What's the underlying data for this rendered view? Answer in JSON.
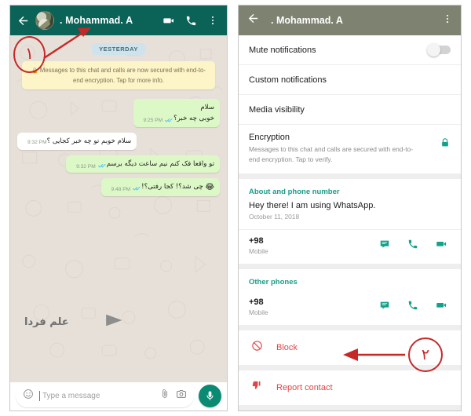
{
  "left_phone": {
    "header": {
      "back_icon": "back-arrow-icon",
      "avatar": "contact-avatar",
      "contact_name": ". Mohammad. A",
      "video_call_icon": "video-call-icon",
      "voice_call_icon": "phone-call-icon",
      "menu_icon": "overflow-menu-icon"
    },
    "chat": {
      "day_divider": "YESTERDAY",
      "encryption_notice": "Messages to this chat and calls are now secured with end-to-end encryption. Tap for more info.",
      "messages": [
        {
          "direction": "out",
          "line1": "سلام",
          "line2": "خوبی چه خبر؟",
          "time": "9:25 PM",
          "status": "read"
        },
        {
          "direction": "in",
          "line1": "سلام خوبم تو چه خبر کجایی ؟",
          "line2": "",
          "time": "9:32 PM",
          "status": "none"
        },
        {
          "direction": "out",
          "line1": "تو واقعا فک کنم نیم ساعت دیگه برسم",
          "line2": "",
          "time": "9:32 PM",
          "status": "read"
        },
        {
          "direction": "out",
          "line1": "چی شد؟! کجا رفتی؟!",
          "line2": "",
          "time": "9:48 PM",
          "status": "read",
          "emoji": "😂"
        }
      ]
    },
    "watermark": {
      "text": "علم فردا",
      "arrow_icon": "right-arrow-icon"
    },
    "composer": {
      "emoji_icon": "emoji-icon",
      "placeholder": "Type a message",
      "attach_icon": "paperclip-icon",
      "camera_icon": "camera-icon",
      "mic_icon": "microphone-icon"
    }
  },
  "right_phone": {
    "header": {
      "back_icon": "back-arrow-icon",
      "contact_name": ". Mohammad. A",
      "menu_icon": "overflow-menu-icon"
    },
    "settings": [
      {
        "label": "Mute notifications",
        "control": "toggle",
        "state": "off"
      },
      {
        "label": "Custom notifications",
        "control": "none"
      },
      {
        "label": "Media visibility",
        "control": "none"
      }
    ],
    "encryption": {
      "title": "Encryption",
      "description": "Messages to this chat and calls are secured with end-to-end encryption. Tap to verify.",
      "icon": "lock-icon"
    },
    "about_section": {
      "heading": "About and phone number",
      "status_text": "Hey there! I am using WhatsApp.",
      "status_date": "October 11, 2018",
      "phone": {
        "number": "+98",
        "type": "Mobile",
        "actions": [
          "message-icon",
          "phone-call-icon",
          "video-call-icon"
        ]
      }
    },
    "other_phones_section": {
      "heading": "Other phones",
      "phone": {
        "number": "+98",
        "type": "Mobile",
        "actions": [
          "message-icon",
          "phone-call-icon",
          "video-call-icon"
        ]
      }
    },
    "danger_actions": [
      {
        "label": "Block",
        "icon": "block-icon"
      },
      {
        "label": "Report contact",
        "icon": "thumbs-down-icon"
      }
    ]
  },
  "annotations": [
    {
      "id": "1",
      "numeral": "۱",
      "points_to": "chat-header"
    },
    {
      "id": "2",
      "numeral": "۲",
      "points_to": "block-row"
    }
  ],
  "colors": {
    "chat_header": "#0b6257",
    "info_header": "#7e8270",
    "outgoing_bubble": "#dcf8c6",
    "incoming_bubble": "#ffffff",
    "accent_teal": "#1a9c8a",
    "danger_red": "#e04545",
    "annotation_red": "#c62828",
    "chat_background": "#e7e0d8"
  }
}
